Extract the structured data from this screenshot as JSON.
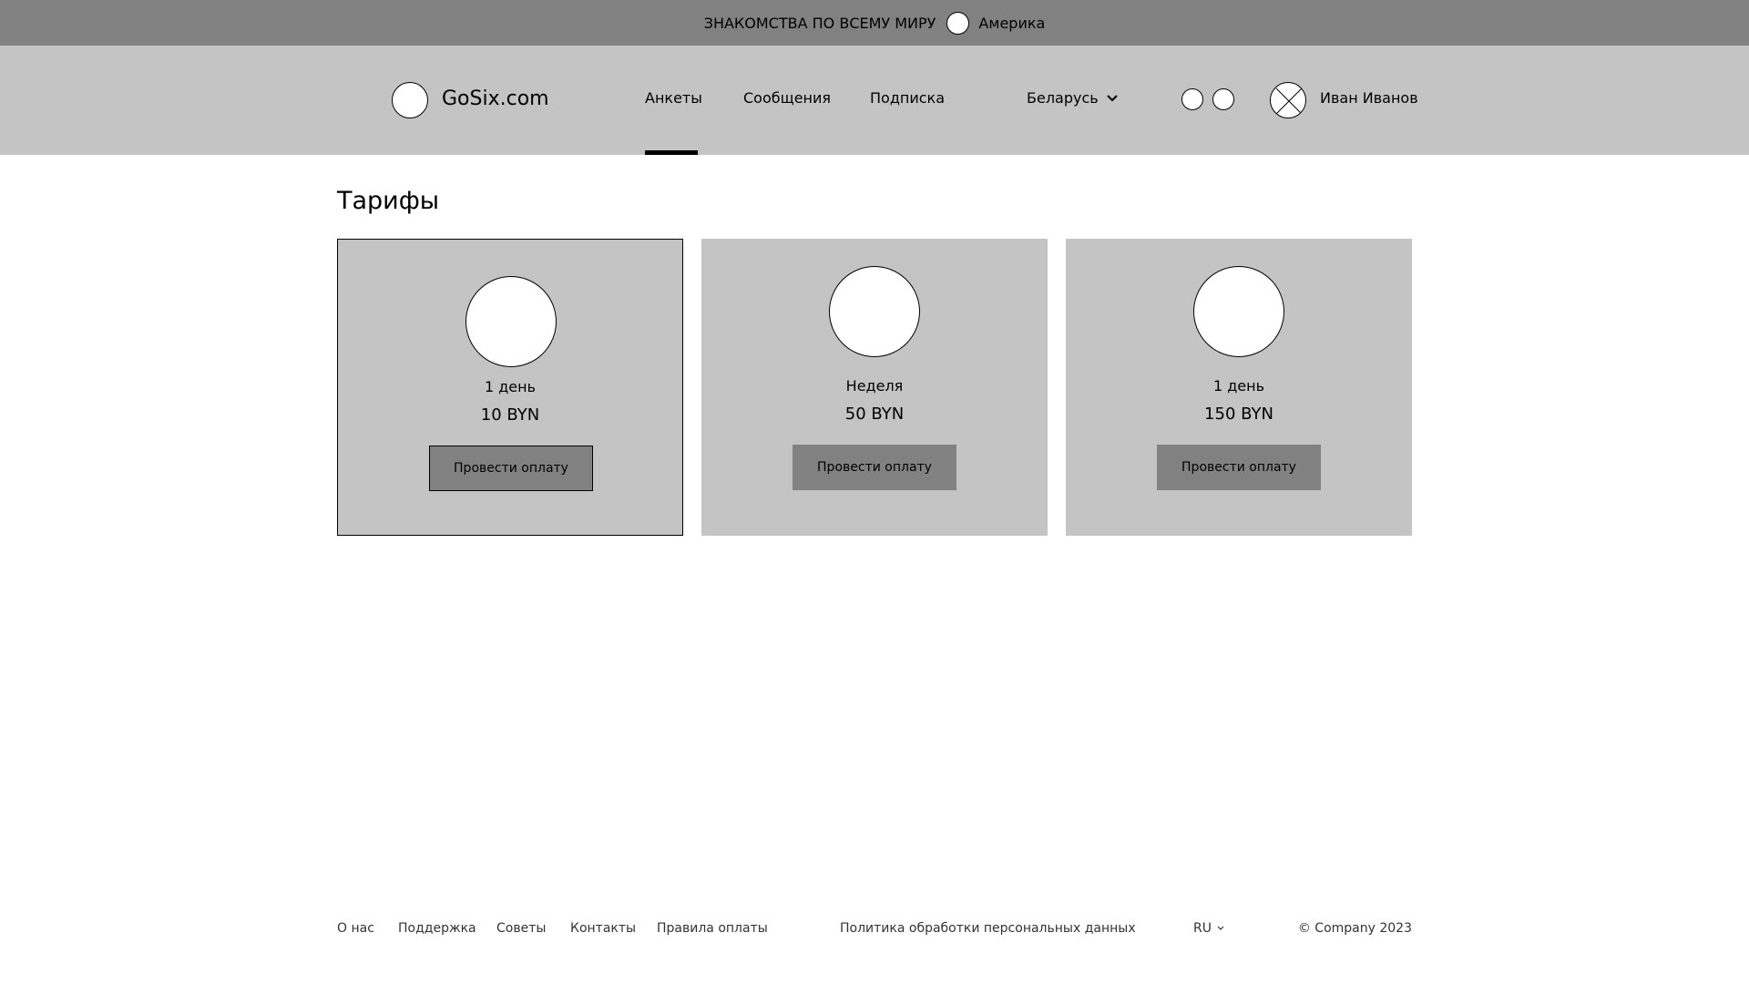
{
  "topbar": {
    "text": "ЗНАКОМСТВА ПО ВСЕМУ МИРУ",
    "region": "Америка"
  },
  "header": {
    "logo": "GoSix.com",
    "nav": [
      {
        "label": "Анкеты",
        "active": true
      },
      {
        "label": "Сообщения",
        "active": false
      },
      {
        "label": "Подписка",
        "active": false
      }
    ],
    "country": "Беларусь",
    "user_name": "Иван Иванов"
  },
  "main": {
    "title": "Тарифы",
    "plans": [
      {
        "period": "1 день",
        "price": "10 BYN",
        "button": "Провести оплату",
        "selected": true
      },
      {
        "period": "Неделя",
        "price": "50 BYN",
        "button": "Провести оплату",
        "selected": false
      },
      {
        "period": "1 день",
        "price": "150 BYN",
        "button": "Провести оплату",
        "selected": false
      }
    ]
  },
  "footer": {
    "links": [
      "О нас",
      "Поддержка",
      "Советы",
      "Контакты",
      "Правила оплаты"
    ],
    "policy": "Политика обработки персональных данных",
    "lang": "RU",
    "copyright": "© Company 2023"
  },
  "colors": {
    "topbar_bg": "#828182",
    "header_bg": "#c4c4c4",
    "card_bg": "#c4c4c4",
    "button_bg": "#828182"
  }
}
